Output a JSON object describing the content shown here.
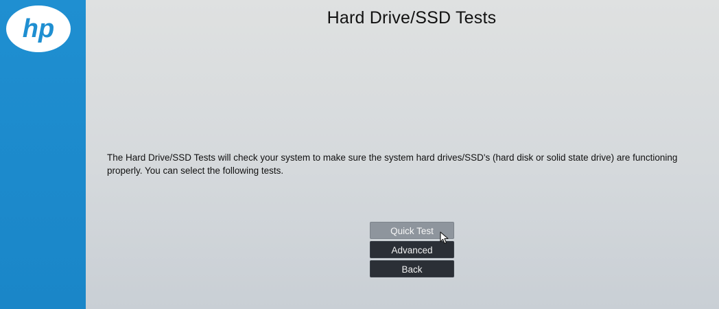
{
  "brand": {
    "logo_text": "hp"
  },
  "page": {
    "title": "Hard Drive/SSD Tests",
    "description": "The Hard Drive/SSD Tests will check your system to make sure the system hard drives/SSD's (hard disk or solid state drive) are functioning properly. You can select the following tests."
  },
  "menu": {
    "items": [
      {
        "label": "Quick Test",
        "selected": true
      },
      {
        "label": "Advanced",
        "selected": false
      },
      {
        "label": "Back",
        "selected": false
      }
    ]
  },
  "colors": {
    "sidebar": "#1f8fd1",
    "background": "#d9dcde",
    "button": "#2b2f36",
    "button_selected": "#8e959d"
  },
  "icons": {
    "logo": "hp-logo-icon",
    "cursor": "mouse-pointer-icon"
  }
}
